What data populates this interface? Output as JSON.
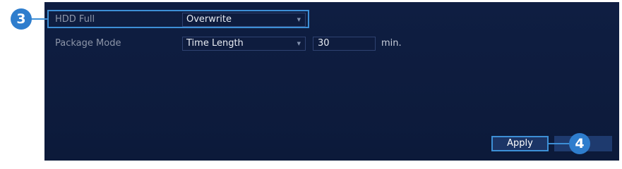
{
  "settings": {
    "hdd_full": {
      "label": "HDD Full",
      "value": "Overwrite"
    },
    "package_mode": {
      "label": "Package Mode",
      "value": "Time Length",
      "duration": "30",
      "unit": "min."
    }
  },
  "buttons": {
    "apply_label": "Apply",
    "back_label": ""
  },
  "callouts": {
    "step_3": "3",
    "step_4": "4"
  },
  "icons": {
    "dropdown": "chevron-down-icon"
  },
  "colors": {
    "panel_background": "#0d1b3b",
    "highlight": "#3d8fd6",
    "callout_fill": "#2e7dcd",
    "label_text": "#8c95a8",
    "value_text": "#e8ecf3"
  }
}
